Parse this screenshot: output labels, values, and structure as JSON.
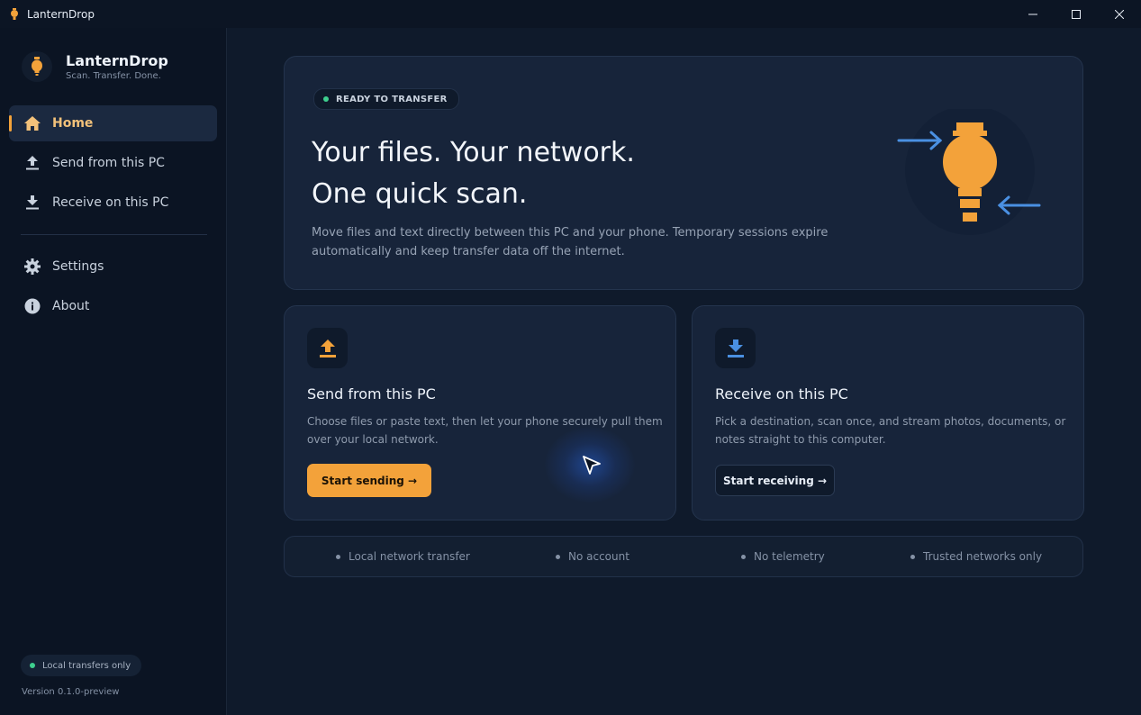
{
  "window": {
    "title": "LanternDrop"
  },
  "sidebar": {
    "brand_name": "LanternDrop",
    "brand_tagline": "Scan. Transfer. Done.",
    "nav": [
      {
        "label": "Home",
        "icon": "home-icon",
        "active": true
      },
      {
        "label": "Send from this PC",
        "icon": "upload-icon",
        "active": false
      },
      {
        "label": "Receive on this PC",
        "icon": "download-icon",
        "active": false
      }
    ],
    "nav_secondary": [
      {
        "label": "Settings",
        "icon": "gear-icon"
      },
      {
        "label": "About",
        "icon": "info-icon"
      }
    ],
    "status_pill": "Local transfers only",
    "version": "Version 0.1.0-preview"
  },
  "hero": {
    "badge": "READY TO TRANSFER",
    "title_line1": "Your files. Your network.",
    "title_line2": "One quick scan.",
    "description": "Move files and text directly between this PC and your phone. Temporary sessions expire automatically and keep transfer data off the internet."
  },
  "send_card": {
    "title": "Send from this PC",
    "description": "Choose files or paste text, then let your phone securely pull them over your local network.",
    "button": "Start sending →"
  },
  "receive_card": {
    "title": "Receive on this PC",
    "description": "Pick a destination, scan once, and stream photos, documents, or notes straight to this computer.",
    "button": "Start receiving →"
  },
  "features": [
    "Local network transfer",
    "No account",
    "No telemetry",
    "Trusted networks only"
  ],
  "colors": {
    "accent": "#f3a23a",
    "status_green": "#3ecf8e",
    "arrow_blue": "#4a90e2",
    "background": "#0f1a2b",
    "card": "#17243a"
  }
}
